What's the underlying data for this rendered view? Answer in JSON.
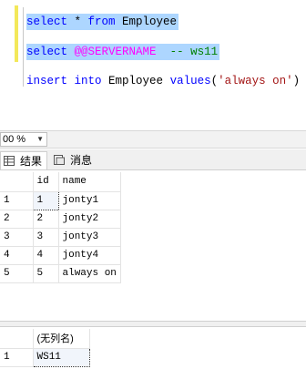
{
  "editor": {
    "lines": [
      {
        "parts": [
          {
            "text": "select",
            "cls": "kw"
          },
          {
            "text": " * ",
            "cls": ""
          },
          {
            "text": "from",
            "cls": "kw"
          },
          {
            "text": " Employee",
            "cls": ""
          }
        ],
        "selected": true
      },
      {
        "parts": [
          {
            "text": "select",
            "cls": "kw"
          },
          {
            "text": " ",
            "cls": ""
          },
          {
            "text": "@@SERVERNAME",
            "cls": "sysvar"
          },
          {
            "text": "  ",
            "cls": ""
          },
          {
            "text": "-- ws11",
            "cls": "cmt"
          }
        ],
        "selected": true
      },
      {
        "parts": [
          {
            "text": "insert",
            "cls": "kw"
          },
          {
            "text": " ",
            "cls": ""
          },
          {
            "text": "into",
            "cls": "kw"
          },
          {
            "text": " Employee ",
            "cls": ""
          },
          {
            "text": "values",
            "cls": "kw"
          },
          {
            "text": "(",
            "cls": ""
          },
          {
            "text": "'always on'",
            "cls": "str"
          },
          {
            "text": ")",
            "cls": ""
          }
        ],
        "selected": false
      }
    ]
  },
  "zoom": {
    "value": "00 %"
  },
  "tabs": {
    "results": "结果",
    "messages": "消息"
  },
  "grid1": {
    "columns": [
      "id",
      "name"
    ],
    "rows": [
      {
        "num": "1",
        "cells": [
          "1",
          "jonty1"
        ]
      },
      {
        "num": "2",
        "cells": [
          "2",
          "jonty2"
        ]
      },
      {
        "num": "3",
        "cells": [
          "3",
          "jonty3"
        ]
      },
      {
        "num": "4",
        "cells": [
          "4",
          "jonty4"
        ]
      },
      {
        "num": "5",
        "cells": [
          "5",
          "always on"
        ]
      }
    ]
  },
  "grid2": {
    "columns": [
      "(无列名)"
    ],
    "rows": [
      {
        "num": "1",
        "cells": [
          "WS11"
        ]
      }
    ]
  }
}
